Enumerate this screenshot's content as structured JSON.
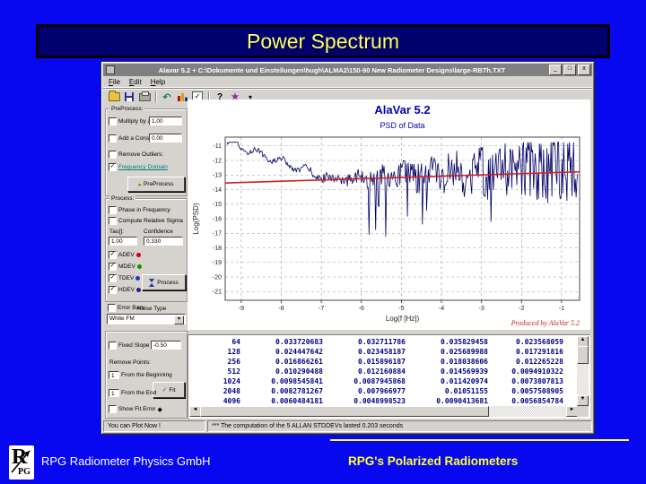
{
  "slide": {
    "title": "Power Spectrum",
    "footer_left": "RPG Radiometer Physics GmbH",
    "footer_right": "RPG's Polarized Radiometers",
    "logo_r": "R",
    "logo_pg": "PG",
    "bg_color": "#0808f0",
    "title_color": "#ffff66"
  },
  "window": {
    "title": "Alavar 5.2 + C:\\Dokumente und Einstellungen\\hugh\\ALMA2\\150-90 New Radiometer Designs\\large-RBTh.TXT",
    "controls": {
      "minimize": "_",
      "maximize": "□",
      "close": "x"
    },
    "menu": [
      {
        "label": "File"
      },
      {
        "label": "Edit"
      },
      {
        "label": "Help"
      }
    ],
    "toolbar": [
      {
        "name": "open-icon",
        "type": "folder"
      },
      {
        "name": "save-icon",
        "type": "floppy"
      },
      {
        "name": "print-icon",
        "type": "printer"
      },
      {
        "name": "separator",
        "type": "sep"
      },
      {
        "name": "replot-icon",
        "type": "undo",
        "glyph": "↶"
      },
      {
        "name": "chart-icon",
        "type": "bars"
      },
      {
        "name": "report-icon",
        "type": "tasks",
        "glyph": "✓"
      },
      {
        "name": "separator",
        "type": "sep"
      },
      {
        "name": "context-help-icon",
        "type": "help",
        "glyph": "?"
      },
      {
        "name": "about-icon",
        "type": "flower",
        "glyph": "★"
      },
      {
        "name": "toolbar-more-icon",
        "type": "caret",
        "glyph": "▾"
      }
    ],
    "status_left": "You can Plot Now !",
    "status_right": "*** The computation of the 5 ALLAN STDDEVs lasted 0.203 seconds"
  },
  "panel": {
    "preprocess": {
      "label": "PreProcess:",
      "multiply_label": "Multiply by a =",
      "multiply_value": "1.00",
      "multiply_checked": false,
      "add_label": "Add a Constant a =",
      "add_value": "0.00",
      "add_checked": false,
      "outliers_label": "Remove Outliers:",
      "outliers_checked": false,
      "freq_label": "Frequency Domain",
      "freq_checked": true,
      "button": "PreProcess"
    },
    "process": {
      "label": "Process:",
      "phase_label": "Phase in Frequency",
      "phase_checked": false,
      "sigma_label": "Compute Relative Sigma",
      "sigma_checked": false,
      "tau_label": "Tau[]:",
      "tau_value": "1.00",
      "conf_label": "Confidence",
      "conf_value": "0.330",
      "devs": [
        {
          "label": "ADEV",
          "color": "#cc0000",
          "checked": true
        },
        {
          "label": "MDEV",
          "color": "#009900",
          "checked": true
        },
        {
          "label": "TDEV",
          "color": "#2233cc",
          "checked": true
        },
        {
          "label": "HDEV",
          "color": "#331d8c",
          "checked": true
        }
      ],
      "button": "Process",
      "error_label": "Error Bars",
      "error_checked": false,
      "noise_label": "Noise Type",
      "noise_value": "White FM"
    },
    "fit": {
      "slope_label": "Fixed Slope =",
      "slope_value": "-0.50",
      "slope_checked": false,
      "remove_label": "Remove Points:",
      "begin_label": "From the Beginning",
      "begin_value": "1",
      "end_label": "From the End",
      "end_value": "1",
      "fit_button": "Fit",
      "show_label": "Show Fit Error",
      "show_checked": false,
      "show_marker": "◆"
    }
  },
  "chart_data": {
    "type": "line",
    "title": "AlaVar 5.2",
    "subtitle": "PSD of Data",
    "xlabel": "Log(f [Hz])",
    "ylabel": "Log(PSD)",
    "xticks": [
      -9,
      -8,
      -7,
      -6,
      -5,
      -4,
      -3,
      -2,
      -1
    ],
    "yticks": [
      -11,
      -12,
      -13,
      -14,
      -15,
      -16,
      -17,
      -18,
      -19,
      -20,
      -21
    ],
    "xlim": [
      -9.4,
      -0.55
    ],
    "ylim": [
      -21.6,
      -10.4
    ],
    "grid": true,
    "series": [
      {
        "name": "psd-noisy-data",
        "color": "#000066",
        "type": "procedural-noise",
        "seed": 12345,
        "points": 420,
        "envelope": {
          "start_level": -10.9,
          "settle_level": -13.4,
          "end_level": -12.8,
          "noise_amp_start": 0.3,
          "noise_amp_end": 4.2,
          "spike_floor": -20.8,
          "spike_chance": 0.055
        }
      },
      {
        "name": "linear-fit",
        "color": "#cc2222",
        "from": [
          -9.4,
          -13.55
        ],
        "to": [
          -0.55,
          -12.78
        ]
      }
    ],
    "annotation": {
      "text": "Produced by AlaVar 5.2",
      "color": "#cc2222",
      "position": "bottom-right"
    }
  },
  "table": {
    "rows": [
      [
        "64",
        "0.033720683",
        "0.032711786",
        "0.035829458",
        "0.023568059"
      ],
      [
        "128",
        "0.024447642",
        "0.023458187",
        "0.025689988",
        "0.017291816"
      ],
      [
        "256",
        "0.016866261",
        "0.015896187",
        "0.018038606",
        "0.012265228"
      ],
      [
        "512",
        "0.010290488",
        "0.012160884",
        "0.014569939",
        "0.0094910322"
      ],
      [
        "1024",
        "0.0098545841",
        "0.0087945868",
        "0.011420974",
        "0.0073807813"
      ],
      [
        "2048",
        "0.0082781267",
        "0.007966977",
        "0.01051155",
        "0.0057508905"
      ],
      [
        "4096",
        "0.0060484181",
        "0.0048998523",
        "0.0090413681",
        "0.0056854784"
      ]
    ]
  }
}
